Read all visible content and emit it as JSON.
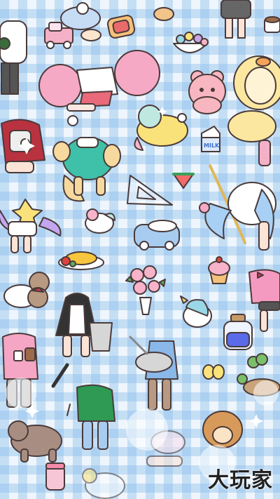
{
  "app": {
    "logo_text": "大玩家",
    "colors": {
      "grid_light": "#eef5fc",
      "grid_blue": "#8fc0ec",
      "pink": "#f7b3c9",
      "teal": "#3fc0a8",
      "yellow": "#f9e27a",
      "brown": "#b89a83",
      "outline": "#4a3a3a"
    }
  },
  "stickers": {
    "milk_carton_label": "MILK"
  }
}
